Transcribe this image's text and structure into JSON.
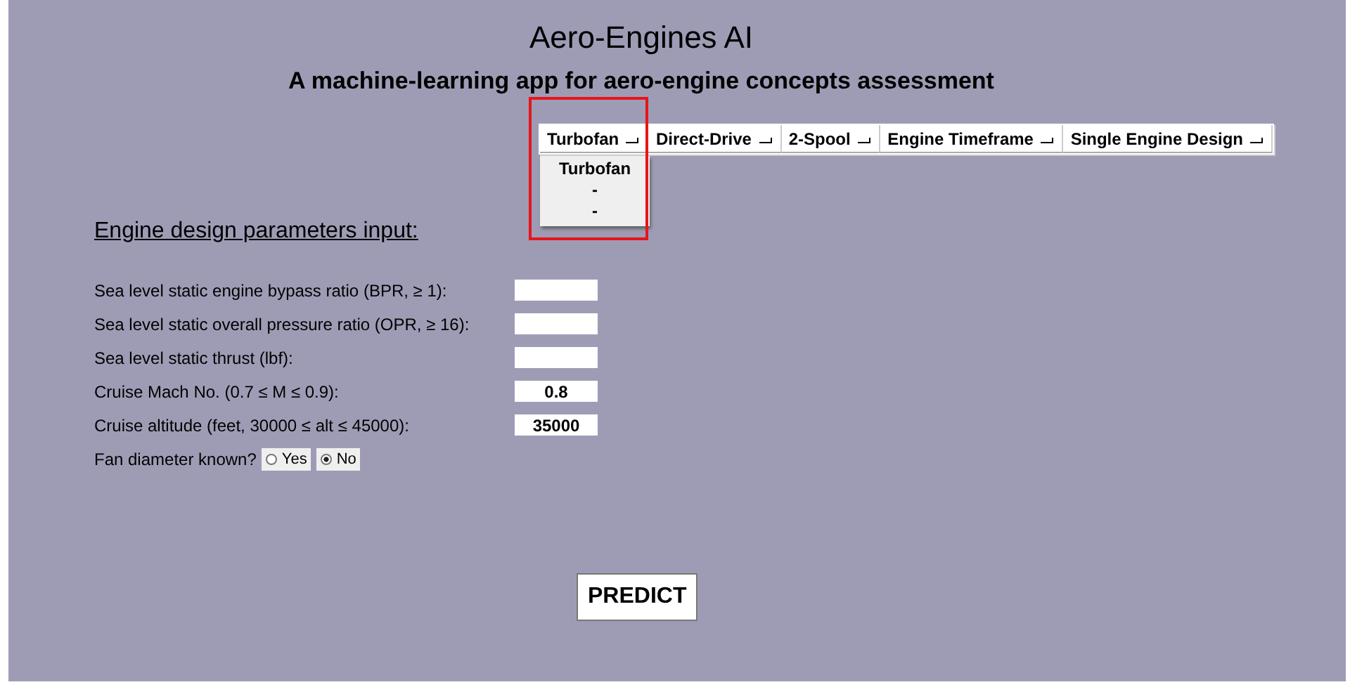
{
  "title": "Aero-Engines AI",
  "subtitle": "A machine-learning app for aero-engine concepts assessment",
  "menus": [
    {
      "label": "Turbofan",
      "expanded": true
    },
    {
      "label": "Direct-Drive",
      "expanded": false
    },
    {
      "label": "2-Spool",
      "expanded": false
    },
    {
      "label": "Engine Timeframe",
      "expanded": false
    },
    {
      "label": "Single Engine Design",
      "expanded": false
    }
  ],
  "dropdown_items": [
    "Turbofan",
    "-",
    "-"
  ],
  "section_heading": "Engine design parameters input:",
  "fields": [
    {
      "label": "Sea level static engine bypass ratio (BPR, ≥ 1):"
    },
    {
      "label": "Sea level static overall pressure ratio (OPR, ≥ 16):"
    },
    {
      "label": "Sea level static thrust (lbf):"
    },
    {
      "label": "Cruise Mach No. (0.7 ≤ M ≤ 0.9):",
      "value": "0.8"
    },
    {
      "label": "Cruise altitude (feet, 30000 ≤ alt ≤ 45000):",
      "value": "35000"
    }
  ],
  "fan_diameter": {
    "label": "Fan diameter known?",
    "options": [
      {
        "label": "Yes",
        "selected": false
      },
      {
        "label": "No",
        "selected": true
      }
    ]
  },
  "predict_button": "PREDICT"
}
